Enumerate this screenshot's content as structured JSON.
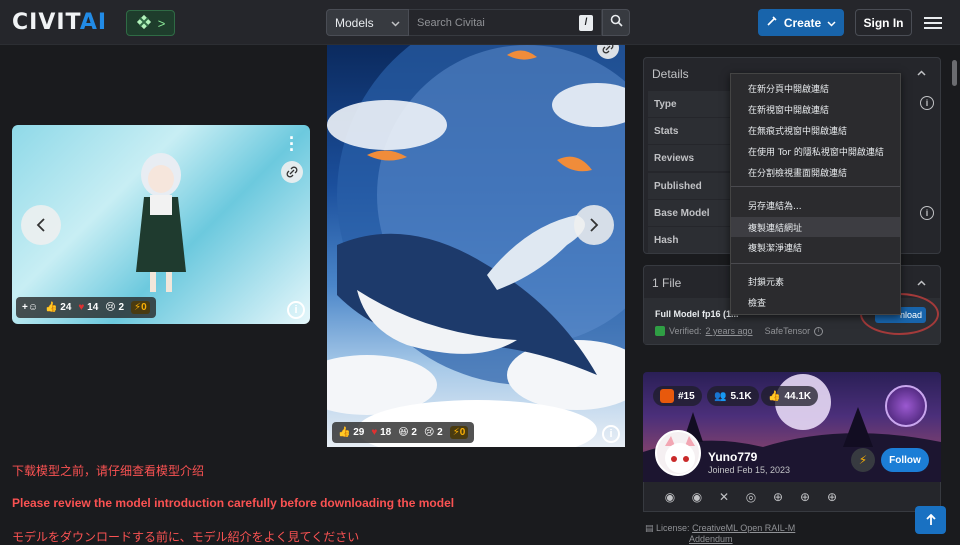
{
  "header": {
    "logo_main": "CIVIT",
    "logo_accent": "AI",
    "event_chevron": ">",
    "search": {
      "scope": "Models",
      "placeholder": "Search Civitai",
      "shortcut": "/"
    },
    "create_label": "Create",
    "signin_label": "Sign In"
  },
  "gallery": {
    "image1": {
      "reactions": {
        "like": "24",
        "heart": "14",
        "cry": "2",
        "buzz": "0"
      }
    },
    "image2": {
      "reactions": {
        "like": "29",
        "heart": "18",
        "laugh": "2",
        "cry": "2",
        "buzz": "0"
      }
    }
  },
  "notices": [
    "下载模型之前，请仔细查看模型介绍",
    "Please review the model introduction carefully before downloading the model",
    "モデルをダウンロードする前に、モデル紹介をよく見てください"
  ],
  "details": {
    "title": "Details",
    "rows": [
      "Type",
      "Stats",
      "Reviews",
      "Published",
      "Base Model",
      "Hash"
    ]
  },
  "context_menu": {
    "items": [
      "在新分頁中開啟連結",
      "在新視窗中開啟連結",
      "在無痕式視窗中開啟連結",
      "在使用 Tor 的隱私視窗中開啟連結",
      "在分割檢視畫面開啟連結",
      "另存連結為...",
      "複製連結網址",
      "複製潔淨連結",
      "封鎖元素",
      "檢查"
    ],
    "selected_index": 6
  },
  "files": {
    "title": "1 File",
    "file_name": "Full Model fp16 (1...",
    "verified_label": "Verified:",
    "verified_time": "2 years ago",
    "safetensor": "SafeTensor",
    "download_label": "nload"
  },
  "creator": {
    "rank": "#15",
    "followers": "5.1K",
    "likes": "44.1K",
    "name": "Yuno779",
    "joined": "Joined Feb 15, 2023",
    "follow_label": "Follow"
  },
  "license": {
    "prefix": "License:",
    "name": "CreativeML Open RAIL-M",
    "addendum": "Addendum"
  },
  "colors": {
    "accent": "#228be6",
    "notice": "#fa5252",
    "buzz": "#fab005"
  }
}
